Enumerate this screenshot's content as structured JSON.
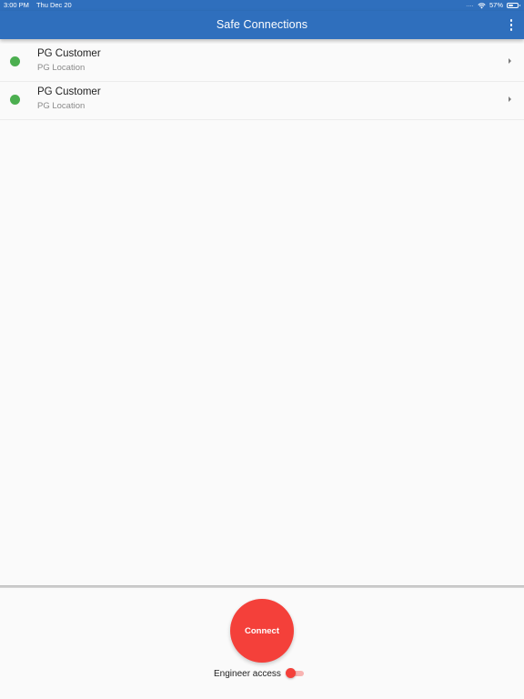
{
  "status_bar": {
    "time": "3:00 PM",
    "date": "Thu Dec 20",
    "signal": "....",
    "battery_percent_label": "57%",
    "battery_level": 0.57
  },
  "app_bar": {
    "title": "Safe Connections",
    "menu_icon": "more-vertical-icon"
  },
  "connections": [
    {
      "title": "PG Customer",
      "subtitle": "PG Location",
      "status_color": "#4caf50"
    },
    {
      "title": "PG Customer",
      "subtitle": "PG Location",
      "status_color": "#4caf50"
    }
  ],
  "bottom": {
    "connect_label": "Connect",
    "engineer_access_label": "Engineer access",
    "engineer_access_enabled": true
  },
  "colors": {
    "primary": "#2f6fbd",
    "accent": "#f4403a",
    "status_online": "#4caf50"
  }
}
